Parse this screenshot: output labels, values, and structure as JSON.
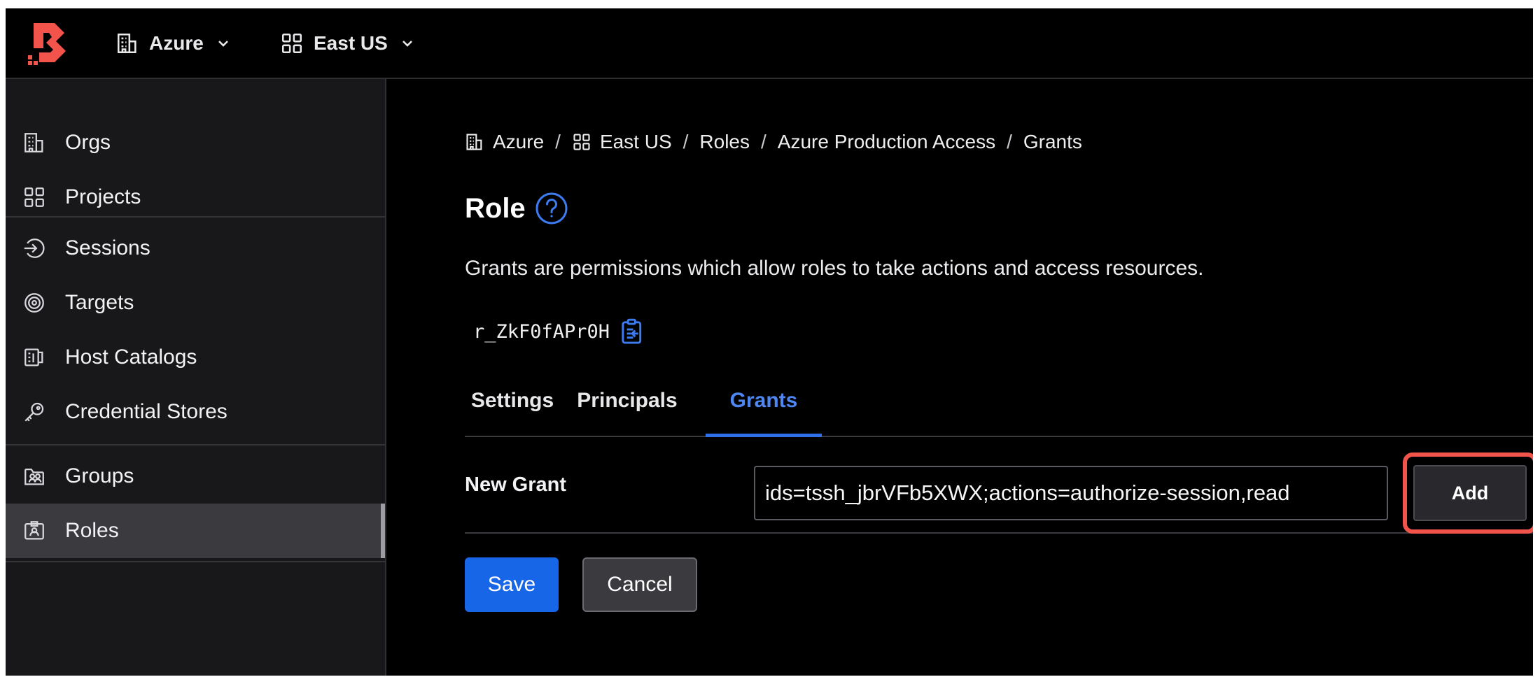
{
  "topbar": {
    "logo": "boundary-logo",
    "scopes": [
      {
        "icon": "building-icon",
        "label": "Azure"
      },
      {
        "icon": "grid-icon",
        "label": "East US"
      }
    ]
  },
  "sidebar": {
    "items": [
      {
        "icon": "building-icon",
        "label": "Orgs"
      },
      {
        "icon": "grid-icon",
        "label": "Projects"
      },
      {
        "icon": "sign-in-icon",
        "label": "Sessions"
      },
      {
        "icon": "target-icon",
        "label": "Targets"
      },
      {
        "icon": "catalog-icon",
        "label": "Host Catalogs"
      },
      {
        "icon": "key-icon",
        "label": "Credential Stores"
      },
      {
        "icon": "users-icon",
        "label": "Groups"
      },
      {
        "icon": "id-badge-icon",
        "label": "Roles"
      }
    ],
    "active": "Roles"
  },
  "breadcrumb": {
    "items": [
      "Azure",
      "East US",
      "Roles",
      "Azure Production Access",
      "Grants"
    ],
    "separator": "/"
  },
  "page": {
    "title": "Role",
    "help_icon": "question-circle-icon",
    "description": "Grants are permissions which allow roles to take actions and access resources.",
    "role_id": "r_ZkF0fAPr0H",
    "copy_icon": "clipboard-copy-icon"
  },
  "tabs": {
    "items": [
      "Settings",
      "Principals",
      "Grants"
    ],
    "active": "Grants"
  },
  "grant_form": {
    "label": "New Grant",
    "value": "ids=tssh_jbrVFb5XWX;actions=authorize-session,read",
    "add_label": "Add",
    "highlight_color": "#f2544b"
  },
  "actions": {
    "save_label": "Save",
    "cancel_label": "Cancel"
  },
  "colors": {
    "accent": "#1866e8",
    "tab_active": "#4e86f2",
    "sidebar_bg": "#18181b",
    "logo": "#f2544b"
  }
}
